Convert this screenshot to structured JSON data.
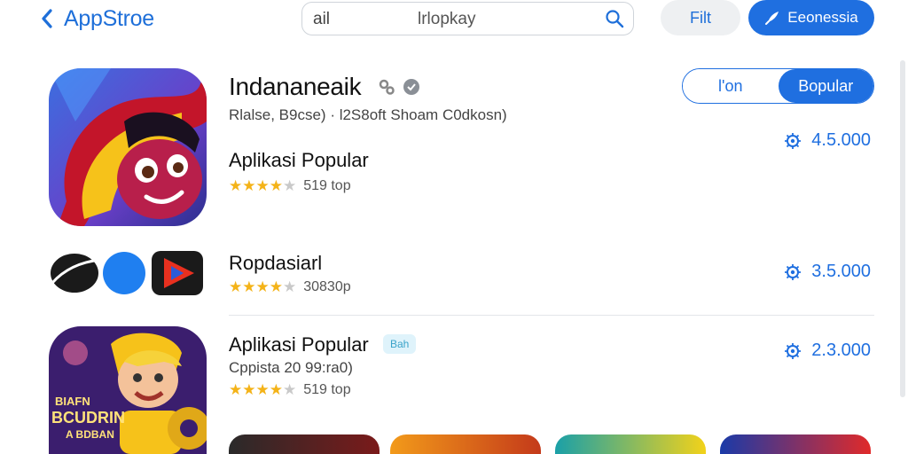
{
  "header": {
    "back_label": "AppStroe",
    "search_value": "ail",
    "search_placeholder": "lrlopkay",
    "filter_label": "Filt",
    "primary_label": "Eeonessia"
  },
  "featured": {
    "title": "Indananeaik",
    "subtitle": "Rlalse, B9cse) · l2S8oft Shoam C0dkosn)",
    "segment_left": "l'on",
    "segment_right": "Bopular"
  },
  "apps": [
    {
      "name": "Aplikasi Popular",
      "rating": 4.5,
      "count": "519 top",
      "price": "4.5.000"
    },
    {
      "name": "Ropdasiarl",
      "rating": 4.5,
      "count": "30830p",
      "price": "3.5.000"
    },
    {
      "name": "Aplikasi Popular",
      "badge": "Bah",
      "subtitle": "Cppista 20 99:ra0)",
      "rating": 4.5,
      "count": "519 top",
      "price": "2.3.000"
    }
  ],
  "game_icon_text": {
    "line1": "BIAFN",
    "line2": "BCUDRIN",
    "line3": "A BDBAN"
  },
  "colors": {
    "accent": "#1f6fe0",
    "star": "#f4b318",
    "badge_bg": "#dff3fb"
  },
  "icons": [
    "chevron-left-icon",
    "search-icon",
    "rocket-icon",
    "gear-icon",
    "verified-icon",
    "price-gear-icon"
  ]
}
